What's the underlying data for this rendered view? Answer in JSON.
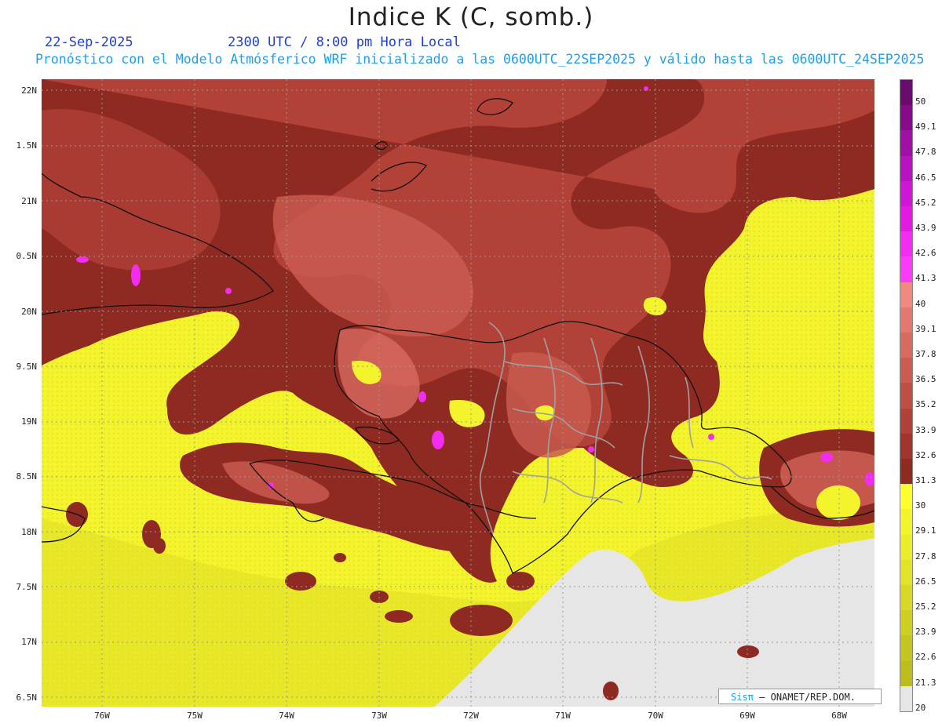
{
  "header": {
    "title": "Indice K (C, somb.)",
    "date": "22-Sep-2025",
    "time": "2300 UTC / 8:00 pm Hora Local",
    "forecast_line": "Pronóstico con el Modelo Atmósferico WRF inicializado a las 0600UTC_22SEP2025 y válido hasta las  0600UTC_24SEP2025"
  },
  "axes": {
    "lat_labels": [
      "22N",
      "1.5N",
      "21N",
      "0.5N",
      "20N",
      "9.5N",
      "19N",
      "8.5N",
      "18N",
      "7.5N",
      "17N",
      "6.5N"
    ],
    "lon_labels": [
      "76W",
      "75W",
      "74W",
      "73W",
      "72W",
      "71W",
      "70W",
      "69W",
      "68W"
    ]
  },
  "colorbar": {
    "labels": [
      "50",
      "49.1",
      "47.8",
      "46.5",
      "45.2",
      "43.9",
      "42.6",
      "41.3",
      "40",
      "39.1",
      "37.8",
      "36.5",
      "35.2",
      "33.9",
      "32.6",
      "31.3",
      "30",
      "29.1",
      "27.8",
      "26.5",
      "25.2",
      "23.9",
      "22.6",
      "21.3",
      "20"
    ],
    "colors": [
      "#6a0a6e",
      "#860a8a",
      "#a010a6",
      "#b812c2",
      "#cf16d6",
      "#e41ae4",
      "#f22cf0",
      "#fa3cfa",
      "#f08a80",
      "#e2786e",
      "#d86a60",
      "#cc5c52",
      "#bf4e44",
      "#b04038",
      "#a1342c",
      "#8f2a22",
      "#ffff2e",
      "#f4f42c",
      "#ecec2a",
      "#e2e228",
      "#d9d925",
      "#cfcf22",
      "#c5c520",
      "#bcbc1c",
      "#e6e6e6"
    ]
  },
  "legend_label_colors": {
    "land_high": "#8a3325",
    "mid": "#c45a4a",
    "low_yellow": "#f2f22c",
    "no_data": "#e6e6e6"
  },
  "credit": {
    "brand": "Sisπ",
    "org": "– ONAMET/REP.DOM."
  }
}
